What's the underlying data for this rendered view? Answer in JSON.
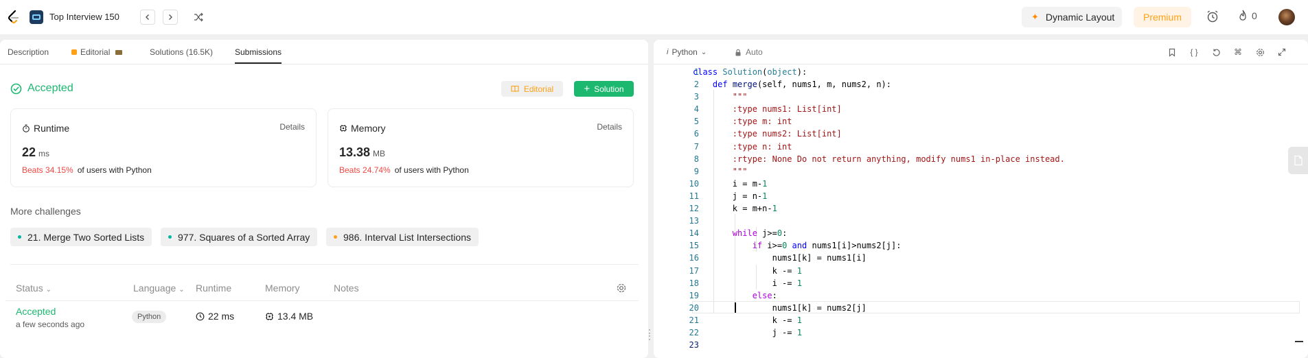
{
  "topbar": {
    "list_title": "Top Interview 150",
    "dynamic_layout": "Dynamic Layout",
    "premium": "Premium",
    "streak_count": "0"
  },
  "left": {
    "tabs": {
      "description": "Description",
      "editorial": "Editorial",
      "solutions": "Solutions (16.5K)",
      "submissions": "Submissions"
    },
    "status": "Accepted",
    "editorial_button": "Editorial",
    "solution_button": "Solution",
    "runtime_card": {
      "title": "Runtime",
      "details": "Details",
      "value": "22",
      "unit": "ms",
      "beats": "Beats 34.15%",
      "beats_rest": "of users with Python"
    },
    "memory_card": {
      "title": "Memory",
      "details": "Details",
      "value": "13.38",
      "unit": "MB",
      "beats": "Beats 24.74%",
      "beats_rest": "of users with Python"
    },
    "more_challenges": "More challenges",
    "challenges": [
      {
        "label": "21. Merge Two Sorted Lists",
        "color": "#00b8a3"
      },
      {
        "label": "977. Squares of a Sorted Array",
        "color": "#00b8a3"
      },
      {
        "label": "986. Interval List Intersections",
        "color": "#ffa116"
      }
    ],
    "table": {
      "headers": {
        "status": "Status",
        "language": "Language",
        "runtime": "Runtime",
        "memory": "Memory",
        "notes": "Notes"
      },
      "row": {
        "status": "Accepted",
        "time": "a few seconds ago",
        "language": "Python",
        "runtime": "22 ms",
        "memory": "13.4 MB"
      }
    }
  },
  "editor": {
    "language": "Python",
    "auto": "Auto",
    "lines": [
      [
        [
          "kw",
          "class "
        ],
        [
          "cls",
          "Solution"
        ],
        [
          "pl",
          "("
        ],
        [
          "cls",
          "object"
        ],
        [
          "pl",
          "):"
        ]
      ],
      [
        [
          "pl",
          "    "
        ],
        [
          "kw",
          "def "
        ],
        [
          "fn",
          "merge"
        ],
        [
          "pl",
          "(self, nums1, m, nums2, n):"
        ]
      ],
      [
        [
          "pl",
          "        "
        ],
        [
          "str",
          "\"\"\""
        ]
      ],
      [
        [
          "pl",
          "        "
        ],
        [
          "str",
          ":type nums1: List[int]"
        ]
      ],
      [
        [
          "pl",
          "        "
        ],
        [
          "str",
          ":type m: int"
        ]
      ],
      [
        [
          "pl",
          "        "
        ],
        [
          "str",
          ":type nums2: List[int]"
        ]
      ],
      [
        [
          "pl",
          "        "
        ],
        [
          "str",
          ":type n: int"
        ]
      ],
      [
        [
          "pl",
          "        "
        ],
        [
          "str",
          ":rtype: None Do not return anything, modify nums1 in-place instead."
        ]
      ],
      [
        [
          "pl",
          "        "
        ],
        [
          "str",
          "\"\"\""
        ]
      ],
      [
        [
          "pl",
          "        i = m-"
        ],
        [
          "num",
          "1"
        ]
      ],
      [
        [
          "pl",
          "        j = n-"
        ],
        [
          "num",
          "1"
        ]
      ],
      [
        [
          "pl",
          "        k = m+n-"
        ],
        [
          "num",
          "1"
        ]
      ],
      [
        [
          "pl",
          ""
        ]
      ],
      [
        [
          "pl",
          "        "
        ],
        [
          "ctl",
          "while "
        ],
        [
          "pl",
          "j>="
        ],
        [
          "num",
          "0"
        ],
        [
          "pl",
          ":"
        ]
      ],
      [
        [
          "pl",
          "            "
        ],
        [
          "ctl",
          "if "
        ],
        [
          "pl",
          "i>="
        ],
        [
          "num",
          "0 "
        ],
        [
          "kw",
          "and "
        ],
        [
          "pl",
          "nums1[i]>nums2[j]:"
        ]
      ],
      [
        [
          "pl",
          "                nums1[k] = nums1[i]"
        ]
      ],
      [
        [
          "pl",
          "                k -= "
        ],
        [
          "num",
          "1"
        ]
      ],
      [
        [
          "pl",
          "                i -= "
        ],
        [
          "num",
          "1"
        ]
      ],
      [
        [
          "pl",
          "            "
        ],
        [
          "ctl",
          "else"
        ],
        [
          "pl",
          ":"
        ]
      ],
      [
        [
          "pl",
          "                nums1[k] = nums2[j]"
        ]
      ],
      [
        [
          "pl",
          "                k -= "
        ],
        [
          "num",
          "1"
        ]
      ],
      [
        [
          "pl",
          "                j -= "
        ],
        [
          "num",
          "1"
        ]
      ],
      [
        [
          "pl",
          "        "
        ]
      ]
    ]
  }
}
